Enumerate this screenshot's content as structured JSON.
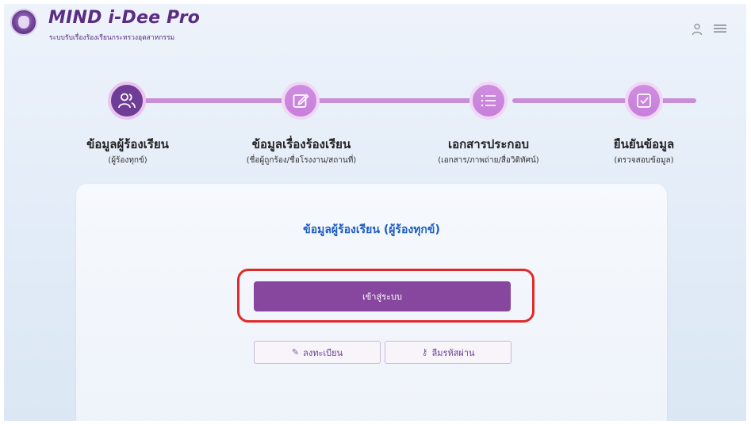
{
  "header": {
    "title": "MIND i-Dee Pro",
    "subtitle": "ระบบรับเรื่องร้องเรียนกระทรวงอุตสาหกรรม",
    "icons": [
      "user-icon",
      "menu-icon"
    ]
  },
  "steps": [
    {
      "title": "ข้อมูลผู้ร้องเรียน",
      "sub": "(ผู้ร้องทุกข์)",
      "icon": "users-icon",
      "active": true
    },
    {
      "title": "ข้อมูลเรื่องร้องเรียน",
      "sub": "(ชื่อผู้ถูกร้อง/ชื่อโรงงาน/สถานที่)",
      "icon": "edit-icon",
      "active": false
    },
    {
      "title": "เอกสารประกอบ",
      "sub": "(เอกสาร/ภาพถ่าย/สื่อวิดิทัศน์)",
      "icon": "list-icon",
      "active": false
    },
    {
      "title": "ยืนยันข้อมูล",
      "sub": "(ตรวจสอบข้อมูล)",
      "icon": "check-square-icon",
      "active": false
    }
  ],
  "card": {
    "title": "ข้อมูลผู้ร้องเรียน (ผู้ร้องทุกข์)",
    "login_label": "เข้าสู่ระบบ",
    "register_label": "ลงทะเบียน",
    "forgot_label": "ลืมรหัสผ่าน",
    "register_icon": "leaf-icon",
    "forgot_icon": "key-icon"
  },
  "colors": {
    "brand": "#5a2d82",
    "active_step": "#6f3c96",
    "inactive_step": "#c77fdb",
    "button": "#87479e",
    "highlight": "#e02a2a",
    "card_title": "#1d5cc0"
  }
}
